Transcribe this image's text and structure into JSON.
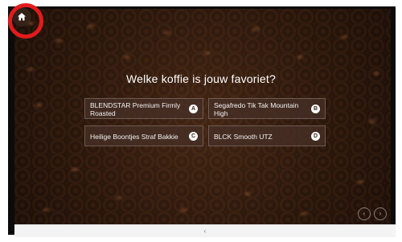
{
  "quiz": {
    "question": "Welke koffie is jouw favoriet?",
    "answers": [
      {
        "letter": "A",
        "label": "BLENDSTAR Premium Firmly Roasted"
      },
      {
        "letter": "B",
        "label": "Segafredo Tik Tak Mountain High"
      },
      {
        "letter": "C",
        "label": "Heilige Boontjes Straf Bakkie"
      },
      {
        "letter": "D",
        "label": "BLCK Smooth UTZ"
      }
    ]
  },
  "navigation": {
    "prev_label": "‹",
    "next_label": "›",
    "bottom_bar_label": "‹"
  },
  "icons": {
    "home": "home-icon"
  },
  "colors": {
    "annotation_circle": "#e21b1b",
    "answer_background": "#463026",
    "text": "#ffffff"
  }
}
